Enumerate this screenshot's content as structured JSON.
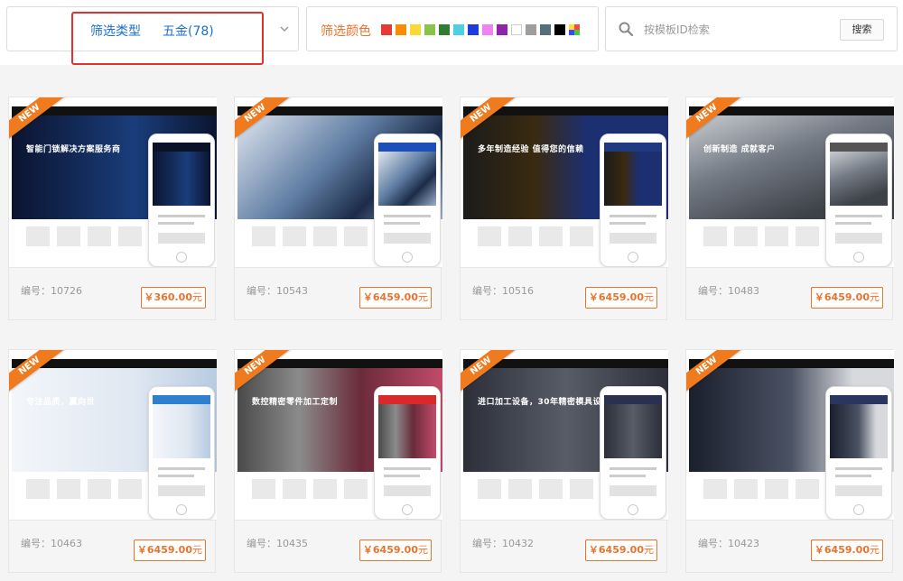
{
  "filter": {
    "type_label": "筛选类型",
    "type_value": "五金(78)",
    "color_label": "筛选颜色",
    "colors": [
      "#e53935",
      "#fb8c00",
      "#fdd835",
      "#8bc34a",
      "#2e7d32",
      "#4dd0e1",
      "#1e3be0",
      "#ee82ee",
      "#8e24aa",
      "#ffffff",
      "#9e9e9e",
      "#546e7a",
      "#000000",
      "multi"
    ],
    "search_placeholder": "按模板ID检索",
    "search_button": "搜索"
  },
  "cards": [
    {
      "badge": "NEW",
      "id_label": "编号：",
      "id": "10726",
      "price": "￥360.00",
      "unit": "元",
      "theme": "#0a1228",
      "hero": "linear-gradient(90deg,#0b1430,#1a3d7a 60%,#0b1430)",
      "headline": "智能门锁解决方案服务商"
    },
    {
      "badge": "NEW",
      "id_label": "编号：",
      "id": "10543",
      "price": "￥6459.00",
      "unit": "元",
      "theme": "#1e4fb8",
      "hero": "linear-gradient(135deg,#dfe6ef,#5f7da3 45%,#1c2c48 70%,#9ab0cc)",
      "headline": ""
    },
    {
      "badge": "NEW",
      "id_label": "编号：",
      "id": "10516",
      "price": "￥6459.00",
      "unit": "元",
      "theme": "#1f3a80",
      "hero": "linear-gradient(90deg,#1b1b1b,#3a2a10 35%,#1c2f70 60%,#1c2f70)",
      "headline": "多年制造经验 值得您的信赖"
    },
    {
      "badge": "NEW",
      "id_label": "编号：",
      "id": "10483",
      "price": "￥6459.00",
      "unit": "元",
      "theme": "#555555",
      "hero": "linear-gradient(160deg,#c9ccd1,#737a84 40%,#3d4148 80%)",
      "headline": "创新制造 成就客户"
    },
    {
      "badge": "NEW",
      "id_label": "编号：",
      "id": "10463",
      "price": "￥6459.00",
      "unit": "元",
      "theme": "#2f7fd0",
      "hero": "linear-gradient(90deg,#f3f6fa,#dfe7f1 60%,#b8cbe1)",
      "headline": "专注品质，赢向世"
    },
    {
      "badge": "NEW",
      "id_label": "编号：",
      "id": "10435",
      "price": "￥6459.00",
      "unit": "元",
      "theme": "#d82a2a",
      "hero": "linear-gradient(90deg,#4a4a4a,#8b8b8b 30%,#6a2b3a 60%,#c24b6a)",
      "headline": "数控精密零件加工定制"
    },
    {
      "badge": "NEW",
      "id_label": "编号：",
      "id": "10432",
      "price": "￥6459.00",
      "unit": "元",
      "theme": "#2a3050",
      "hero": "linear-gradient(90deg,#2c2f3a,#585c66 50%,#2c2f3a)",
      "headline": "进口加工设备，30年精密模具设计"
    },
    {
      "badge": "NEW",
      "id_label": "编号：",
      "id": "10423",
      "price": "￥6459.00",
      "unit": "元",
      "theme": "#2a3560",
      "hero": "linear-gradient(90deg,#1a1f2c,#4b5263 50%,#d7d9dc 80%)",
      "headline": ""
    }
  ]
}
